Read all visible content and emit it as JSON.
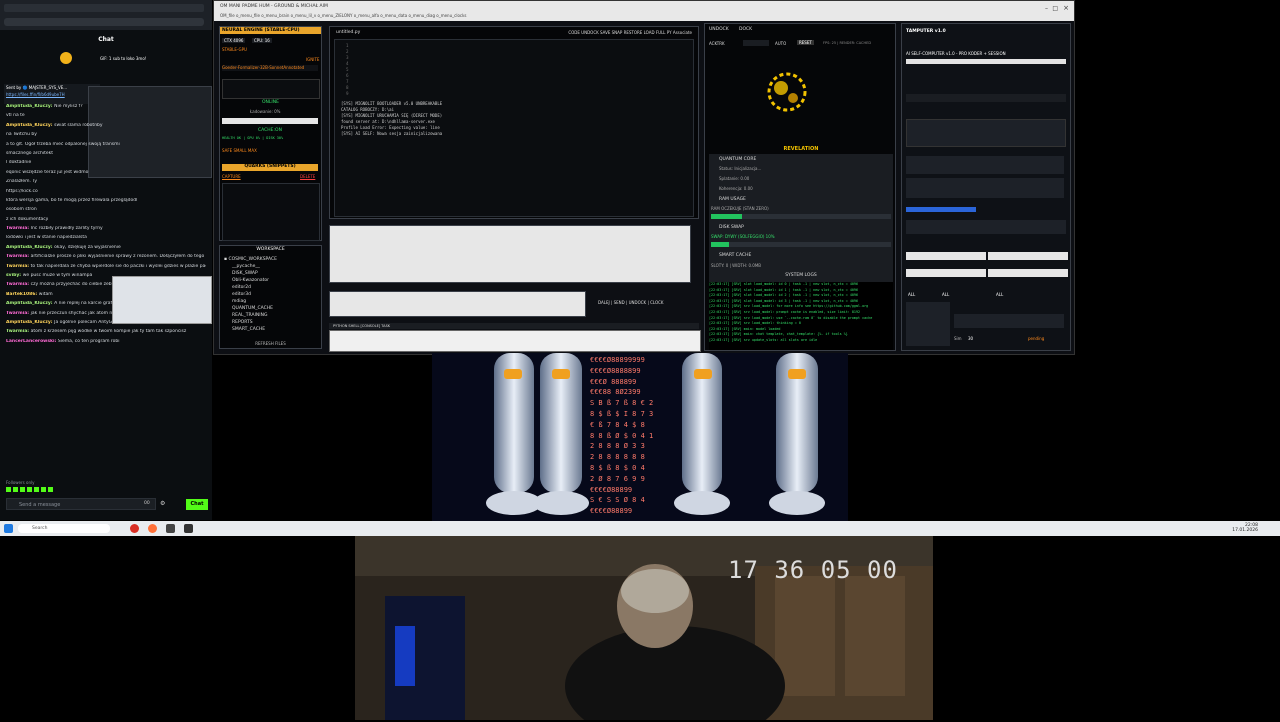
{
  "chat": {
    "title": "Chat",
    "pinned": "Sent by 🔵 MAJSTER_SYS_VE...",
    "link": "https://files.ffin/fl/b6d9ube7H",
    "messages": [
      {
        "user": "Amplituda_Kluczy:",
        "text": "Nie mylisz f?"
      },
      {
        "user": "",
        "text": "vtl na te"
      },
      {
        "user": "Amplituda_Kluczy:",
        "text": "swiat slama robotnby"
      },
      {
        "user": "",
        "text": "na Twitchu by"
      },
      {
        "user": "",
        "text": "a to glt. Ogół trzeba mieć odpalonej swoją transmi"
      },
      {
        "user": "",
        "text": "smacznego architekt"
      },
      {
        "user": "",
        "text": "I doktadnie"
      },
      {
        "user": "",
        "text": "eqonic wszędzie teraz jul jest widmo"
      },
      {
        "user": "",
        "text": "Znalazłem. Ty"
      },
      {
        "user": "",
        "text": "https://kick.co"
      },
      {
        "user": "",
        "text": "która wersja gama, bo te mogą przez firewala przeglądodl"
      },
      {
        "user": "",
        "text": "osobom stron"
      },
      {
        "user": "",
        "text": "z ich dokumentacji"
      },
      {
        "user": "Twarmia:",
        "text": "Inc rozbiły prawidły zarlity tyrny"
      },
      {
        "user": "",
        "text": "lodówki i jest w stanie napiedzialsta"
      },
      {
        "user": "Amplituda_Kluczy:",
        "text": "okay, dziękuję za wyjaśnienie"
      },
      {
        "user": "Twarmia:",
        "text": "artificialzie prosze o pliki wyjaśnienie sprawy z rezonem. Dołączyłem do tego grona. Mecz się od tygodni z rezonem a ty nie podasz żadnych wskazówek działania."
      },
      {
        "user": "Twarmia:",
        "text": "to tak napierdala ze chyba wpierdole sie do paczki i wyslei gdzies w plazie paczkomatem moze obok delikatesów centrum w drobnie spoko ok to plne"
      },
      {
        "user": "sviby:",
        "text": "we pusc muze w tym winampa"
      },
      {
        "user": "Twarmia:",
        "text": "czy mozna przyjechac do ciebie zebys nauczyl mnie obcowac z rezonem?"
      },
      {
        "user": "Bartek1086:",
        "text": "witam"
      },
      {
        "user": "Amplituda_Kluczy:",
        "text": "A nie replej na karcie graficznej odpalić AI?"
      },
      {
        "user": "Twarmia:",
        "text": "jak nie przeczuli shychać jak atom napierdala razem z krzesem"
      },
      {
        "user": "Amplituda_Kluczy:",
        "text": "Ja ogólnie polecam AntyGravity, super się pracuje"
      },
      {
        "user": "Twarmia:",
        "text": "atom z krzesem pijg wódke w twoim kompie jak ty tam tak szponcisz"
      },
      {
        "user": "LancerLancerowski:",
        "text": "Siema, co ten program robi"
      }
    ],
    "followers_only": "Followers only",
    "input_placeholder": "Send a message",
    "send_label": "Chat",
    "viewer_count": "00"
  },
  "app": {
    "window_title": "OM MANI PADME HUM - GROUND & MICHAŁ AIM",
    "menu": "OM_file   o_menu_file   o_menu_brain   o_menu_lil_v   o_menu_ZIELONY   o_menu_alfa   o_menu_data   o_menu_diag   o_menu_clocks",
    "neural_engine": "NEURAL ENGINE (STABLE-CPU)",
    "ctx_label": "CTX 4096",
    "cpu_label": "CPU: 16",
    "model_name": "Goeder-Formalizer-32B-SonnetAnnotated",
    "ignite": "IGNITE",
    "online": "ONLINE",
    "ladowanie": "Ładowanie: 0%",
    "cache": "CACHE:ON",
    "quarks": "QUARKS (SNIPPETS)",
    "capture": "CAPTURE",
    "delete": "DELETE",
    "workspace": "WORKSPACE",
    "workspace_items": [
      "COSMIC_WORKSPACE",
      "__pycache__",
      "DISK_SWAP",
      "Obli-Kwazonator",
      "editor2d",
      "editor3d",
      "mdiag",
      "QUANTUM_CACHE",
      "REAL_TRAINING",
      "REPORTS",
      "SMART_CACHE"
    ],
    "refresh": "REFRESH FILES",
    "editor_tab": "untitled.py",
    "editor_menu": "CODE  UNDOCK  SAVE  SNAP  RESTORE  LOAD FULL PY  Associate",
    "console_lines": [
      "[SYS] MIGNOLIT BOOTLOADER v5.0 UNBREAKABLE",
      "CATALOG ROBOCZY: D:\\ai",
      "[SYS] MIGNOLIT URUCHAMIA SIĘ (DIRECT MODE)",
      "found server at: D:\\ndhllama-server.exe",
      "Profile Load Error: Expecting value: line",
      "[SYS] AI SELF: Nowa sesja zainicjalizowana"
    ],
    "dalej": "DALEJ",
    "send": "SEND",
    "undock": "UNDOCK",
    "clock_btn": "CLOCK",
    "status_bar": "PYTHON SHELL  [CONSOLE] TASK",
    "undock_tab": "UNDOCK",
    "dock_tab": "DOCK",
    "akt_label": "ACKTRK",
    "auto": "AUTO",
    "reset": "RESET",
    "fps": "FPS: 25 | RENDER: CACHED",
    "revelation": "REVELATION",
    "quantum_core": "QUANTUM CORE",
    "status": "Status: Inicjalizacja...",
    "splatanie": "Splatanie: 0.00",
    "koherencja": "Koherencja: 0.00",
    "ram_usage": "RAM USAGE",
    "ram_detail": "RAM OCZEKUJE (STAN ZERO)",
    "disk_swap": "DISK SWAP",
    "swap_detail": "SWAP: DYWY (SOLFEGGIO) 10%",
    "smart_cache": "SMART CACHE",
    "slots": "SLOTY: 0 | WIDTH: 0.0MB",
    "system_logs": "SYSTEM LOGS",
    "log_lines": [
      "[22:03:17] [SRV] slot  load_model: id 0 | task -1 | new slot, n_ctx = 4096",
      "[22:03:17] [SRV] slot  load_model: id 1 | task -1 | new slot, n_ctx = 4096",
      "[22:03:17] [SRV] slot  load_model: id 2 | task -1 | new slot, n_ctx = 4096",
      "[22:03:17] [SRV] slot  load_model: id 3 | task -1 | new slot, n_ctx = 4096",
      "[22:03:17] [SRV] srv   load_model: for more info see https://github.com/ggml-org",
      "[22:03:17] [SRV] srv   load_model: prompt cache is enabled, size limit: 8192",
      "[22:03:17] [SRV] srv   load_model: use `--cache-ram 0` to disable the prompt cache",
      "[22:03:17] [SRV] srv   load_model: thinking = 0",
      "[22:03:17] [SRV] main: model loaded",
      "[22:03:17] [SRV] main: chat template, chat_template: {%- if tools %}",
      "[22:03:17] [SRV] srv   update_slots: all slots are idle"
    ],
    "tamper_title": "TAMPUTER v1.0",
    "tamper_sub": "AI SELF-COMPUTER v1.0 - PRO KODER + SESSION",
    "all_1": "ALL",
    "all_2": "ALL",
    "all_3": "ALL",
    "pending": "pending",
    "sim_label": "Sim",
    "sim_value": "30"
  },
  "matrix_text": [
    "€€€€Ø88899999",
    "€€€€Ø8888899",
    "€€€Ø 888899",
    "€€€88 8Ø2399",
    "S B ß 7 ß 8 € 2",
    "8 $ ß $ I 8 7 3",
    "€ ß 7 8 4 $ 8",
    "8 8 ß Ø $ 0 4 1",
    "2 8 8 8 Ø 3 3",
    "2 8 8 8 8 8 8",
    "8 $ ß 8 $ 0 4",
    "2 Ø 8 7 6 9 9",
    "€€€€Ø88899",
    "S € S S Ø 8 4",
    "€€€€Ø88899"
  ],
  "video_clock": "17 36 05 00",
  "taskbar": {
    "search": "Search",
    "time": "22:08",
    "date": "17.01.2026"
  }
}
